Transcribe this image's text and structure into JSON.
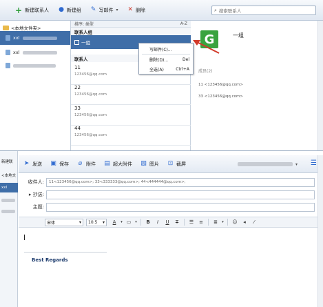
{
  "top": {
    "toolbar": {
      "new_contact": "新建联系人",
      "new_group": "新建组",
      "compose": "写邮件",
      "delete": "删除"
    },
    "search_placeholder": "搜索联系人",
    "local_folder": "<本地文件夹>",
    "accounts": [
      "xxl",
      "xxl",
      ""
    ],
    "sort_label": "排序: 类型",
    "sort_az": "A-Z",
    "section_groups": "联系人组",
    "group_name": "一组",
    "section_contacts": "联系人",
    "contacts": [
      {
        "name": "11",
        "email": "123456@qq.com"
      },
      {
        "name": "22",
        "email": "123456@qq.com"
      },
      {
        "name": "33",
        "email": "123456@qq.com"
      },
      {
        "name": "44",
        "email": "123456@qq.com"
      }
    ],
    "context_menu": [
      {
        "label": "写邮件(C)...",
        "shortcut": ""
      },
      {
        "label": "删除(D)...",
        "shortcut": "Del"
      },
      {
        "label": "全选(A)",
        "shortcut": "Ctrl+A"
      }
    ],
    "detail": {
      "title": "一组",
      "members_label": "成员(2)",
      "member_lines": [
        "11 <123456@qq.com>",
        "33 <123456@qq.com>"
      ],
      "icon_letter": "G"
    }
  },
  "bottom": {
    "left_items": [
      "新建联",
      "<本地文",
      "xxl",
      "",
      ""
    ],
    "toolbar": {
      "send": "发送",
      "save": "保存",
      "attach": "附件",
      "big_attach": "超大附件",
      "image": "图片",
      "screenshot": "截屏"
    },
    "to_label": "收件人:",
    "to_value": "11<123456@qq.com>; 33<333333@qq.com>; 44<444444@qq.com>;",
    "cc_label": "抄送:",
    "subject_label": "主题:",
    "font_name": "宋体",
    "font_size": "10.5",
    "signature": "Best Regards"
  },
  "colors": {
    "selection": "#3f6ea8",
    "accent": "#2f6ad0",
    "group_icon": "#3aa33f",
    "arrow": "#d23a2a"
  }
}
